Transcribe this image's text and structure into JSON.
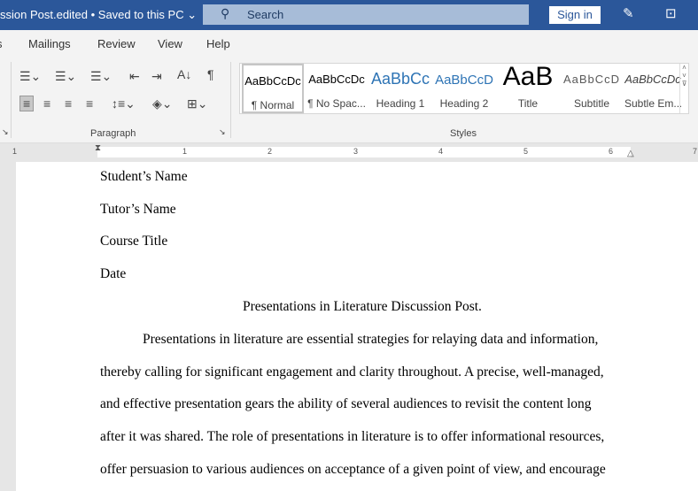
{
  "titlebar": {
    "doc_title": "ssion Post.edited • Saved to this PC ⌄",
    "search_placeholder": "Search",
    "sign_in": "Sign in"
  },
  "menu": [
    "s",
    "Mailings",
    "Review",
    "View",
    "Help"
  ],
  "ribbon": {
    "paragraph_label": "Paragraph",
    "styles_label": "Styles",
    "styles": [
      {
        "preview": "AaBbCcDc",
        "name": "¶ Normal"
      },
      {
        "preview": "AaBbCcDc",
        "name": "¶ No Spac..."
      },
      {
        "preview": "AaBbCc",
        "name": "Heading 1"
      },
      {
        "preview": "AaBbCcD",
        "name": "Heading 2"
      },
      {
        "preview": "AaB",
        "name": "Title"
      },
      {
        "preview": "AaBbCcD",
        "name": "Subtitle"
      },
      {
        "preview": "AaBbCcDc",
        "name": "Subtle Em..."
      }
    ]
  },
  "ruler": [
    "1",
    "1",
    "2",
    "3",
    "4",
    "5",
    "6",
    "7"
  ],
  "document": {
    "lines": [
      "Student’s Name",
      "Tutor’s Name",
      "Course Title",
      "Date",
      "Presentations in Literature Discussion Post.",
      "Presentations in literature are essential strategies for relaying data and information,",
      "thereby calling for significant engagement and clarity throughout. A precise, well-managed,",
      "and effective presentation gears the ability of several audiences to revisit the content long",
      "after it was shared. The role of presentations in literature is to offer informational resources,",
      "offer persuasion to various audiences on acceptance of a given point of view, and encourage"
    ]
  }
}
